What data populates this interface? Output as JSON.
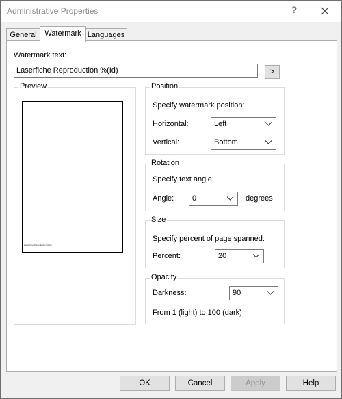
{
  "window": {
    "title": "Administrative Properties",
    "help_glyph": "?"
  },
  "tabs": [
    {
      "label": "General"
    },
    {
      "label": "Watermark"
    },
    {
      "label": "Languages"
    }
  ],
  "watermark": {
    "text_label": "Watermark text:",
    "text_value": "Laserfiche Reproduction %(Id)",
    "expand_button": ">"
  },
  "preview": {
    "title": "Preview",
    "sample_text": "Laserfiche Reproduction %(Id)"
  },
  "position": {
    "title": "Position",
    "description": "Specify watermark position:",
    "horizontal_label": "Horizontal:",
    "horizontal_value": "Left",
    "vertical_label": "Vertical:",
    "vertical_value": "Bottom"
  },
  "rotation": {
    "title": "Rotation",
    "description": "Specify text angle:",
    "angle_label": "Angle:",
    "angle_value": "0",
    "unit": "degrees"
  },
  "size": {
    "title": "Size",
    "description": "Specify percent of page spanned:",
    "percent_label": "Percent:",
    "percent_value": "20"
  },
  "opacity": {
    "title": "Opacity",
    "darkness_label": "Darkness:",
    "darkness_value": "90",
    "hint": "From 1 (light) to 100 (dark)"
  },
  "footer": {
    "ok": "OK",
    "cancel": "Cancel",
    "apply": "Apply",
    "help": "Help"
  }
}
